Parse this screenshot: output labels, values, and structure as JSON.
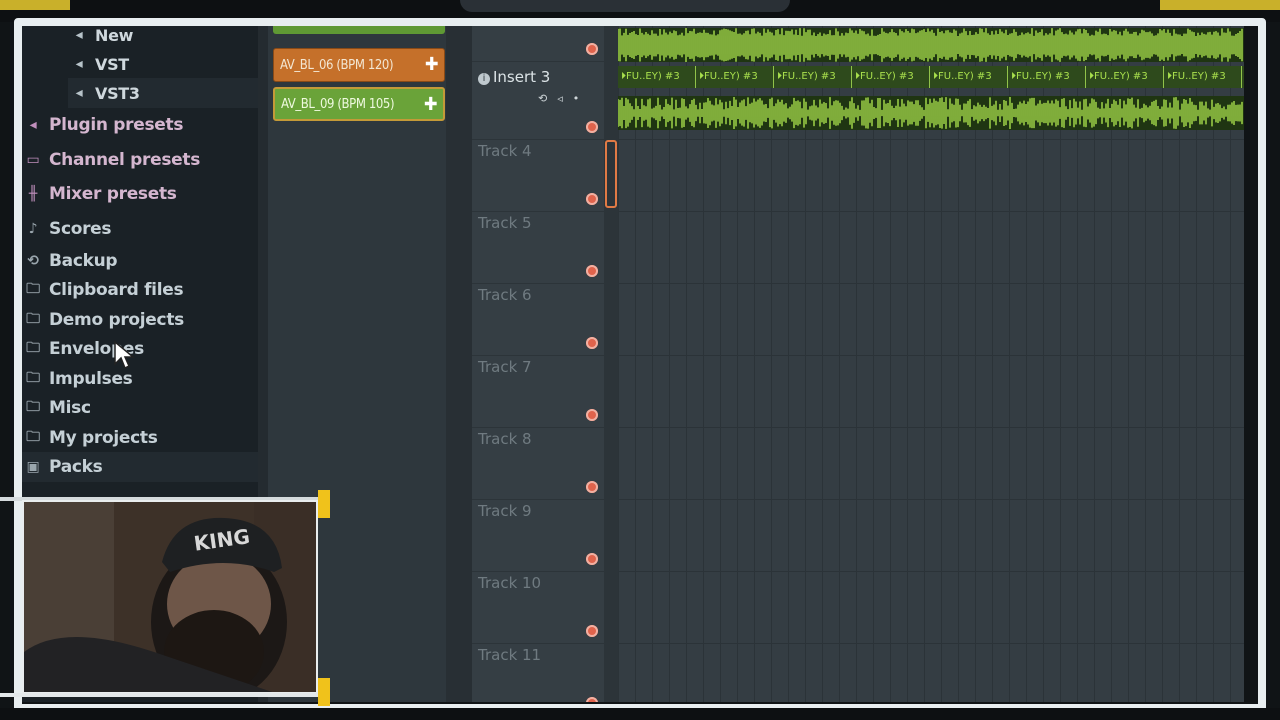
{
  "browser": {
    "items": [
      {
        "label": "New",
        "icon": "plugin-icon",
        "glyph": "◂"
      },
      {
        "label": "VST",
        "icon": "plugin-icon",
        "glyph": "◂"
      },
      {
        "label": "VST3",
        "icon": "plugin-icon",
        "glyph": "◂"
      },
      {
        "label": "Plugin presets",
        "icon": "plugin-presets-icon",
        "glyph": "◂"
      },
      {
        "label": "Channel presets",
        "icon": "channel-presets-icon",
        "glyph": "▭"
      },
      {
        "label": "Mixer presets",
        "icon": "mixer-presets-icon",
        "glyph": "╫"
      },
      {
        "label": "Scores",
        "icon": "note-icon",
        "glyph": "♪"
      },
      {
        "label": "Backup",
        "icon": "backup-folder-icon",
        "glyph": "⟲"
      },
      {
        "label": "Clipboard files",
        "icon": "folder-icon",
        "glyph": "🗀"
      },
      {
        "label": "Demo projects",
        "icon": "folder-icon",
        "glyph": "🗀"
      },
      {
        "label": "Envelopes",
        "icon": "folder-icon",
        "glyph": "🗀"
      },
      {
        "label": "Impulses",
        "icon": "folder-icon",
        "glyph": "🗀"
      },
      {
        "label": "Misc",
        "icon": "folder-icon",
        "glyph": "🗀"
      },
      {
        "label": "My projects",
        "icon": "folder-icon",
        "glyph": "🗀"
      },
      {
        "label": "Packs",
        "icon": "packs-folder-icon",
        "glyph": "▣"
      }
    ]
  },
  "patterns": {
    "items": [
      {
        "label": "AV_BL_06 (BPM 120)",
        "color": "#c5702a"
      },
      {
        "label": "AV_BL_09 (BPM 105)",
        "color": "#6aa339"
      }
    ],
    "plus_glyph": "✚"
  },
  "playlist": {
    "insert_label": "Insert 3",
    "pattern_clip_label": "⏵FU..EY) #3",
    "tracks": [
      {
        "label": "Track 4"
      },
      {
        "label": "Track 5"
      },
      {
        "label": "Track 6"
      },
      {
        "label": "Track 7"
      },
      {
        "label": "Track 8"
      },
      {
        "label": "Track 9"
      },
      {
        "label": "Track 10"
      },
      {
        "label": "Track 11"
      }
    ]
  },
  "colors": {
    "wave_green": "#a9e04d",
    "pattern_orange": "#c5702a",
    "pattern_green": "#6aa339",
    "frame_accent": "#f0c21b"
  },
  "webcam": {
    "hat_text": "KING"
  }
}
